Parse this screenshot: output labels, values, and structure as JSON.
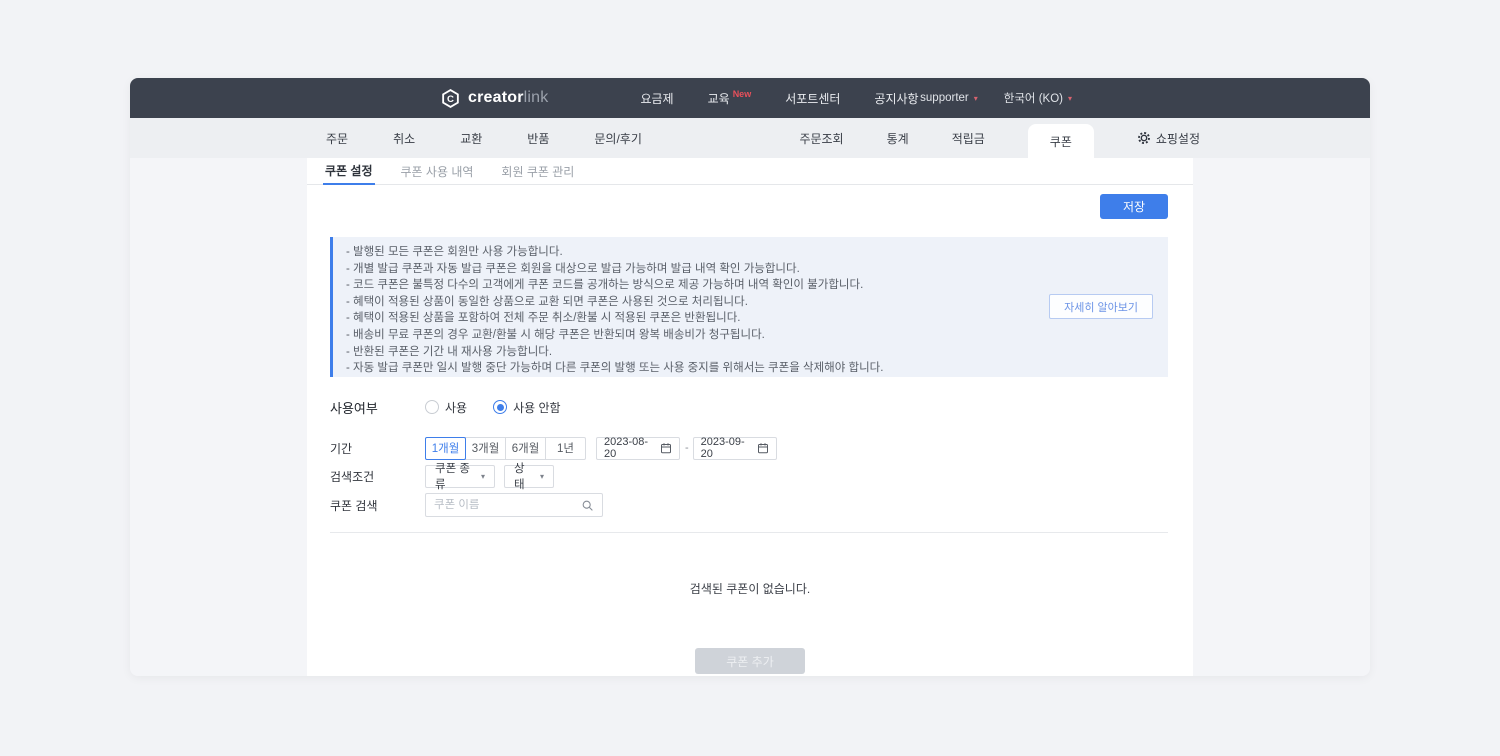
{
  "topnav": {
    "brand": {
      "bold": "creator",
      "light": "link"
    },
    "menu": [
      {
        "label": "요금제"
      },
      {
        "label": "교육",
        "badge": "New"
      },
      {
        "label": "서포트센터"
      },
      {
        "label": "공지사항"
      }
    ],
    "account": {
      "label": "supporter"
    },
    "language": {
      "label": "한국어 (KO)"
    }
  },
  "subnav": {
    "left": [
      "주문",
      "취소",
      "교환",
      "반품",
      "문의/후기"
    ],
    "right": [
      "주문조회",
      "통계",
      "적립금"
    ],
    "active_tab": "쿠폰",
    "settings_label": "쇼핑설정"
  },
  "coupon_tabs": [
    {
      "label": "쿠폰 설정",
      "active": true
    },
    {
      "label": "쿠폰 사용 내역",
      "active": false
    },
    {
      "label": "회원 쿠폰 관리",
      "active": false
    }
  ],
  "toolbar": {
    "save_label": "저장"
  },
  "notice": {
    "lines": [
      "- 발행된 모든 쿠폰은 회원만 사용 가능합니다.",
      "- 개별 발급 쿠폰과 자동 발급 쿠폰은 회원을 대상으로 발급 가능하며 발급 내역 확인 가능합니다.",
      "- 코드 쿠폰은 불특정 다수의 고객에게 쿠폰 코드를 공개하는 방식으로 제공 가능하며 내역 확인이 불가합니다.",
      "- 혜택이 적용된 상품이 동일한 상품으로 교환 되면 쿠폰은 사용된 것으로 처리됩니다.",
      "- 혜택이 적용된 상품을 포함하여 전체 주문 취소/환불 시 적용된 쿠폰은 반환됩니다.",
      "- 배송비 무료 쿠폰의 경우 교환/환불 시 해당 쿠폰은 반환되며 왕복 배송비가 청구됩니다.",
      "- 반환된 쿠폰은 기간 내 재사용 가능합니다.",
      "- 자동 발급 쿠폰만 일시 발행 중단 가능하며 다른 쿠폰의 발행 또는 사용 중지를 위해서는 쿠폰을 삭제해야 합니다."
    ],
    "learn_more_label": "자세히 알아보기"
  },
  "form": {
    "usage": {
      "label": "사용여부",
      "option_use": "사용",
      "option_disable": "사용 안함",
      "selected": "사용 안함"
    },
    "period": {
      "label": "기간",
      "presets": [
        "1개월",
        "3개월",
        "6개월",
        "1년"
      ],
      "selected_preset": "1개월",
      "start_date": "2023-08-20",
      "end_date": "2023-09-20",
      "separator": "-"
    },
    "condition": {
      "label": "검색조건",
      "type_dropdown": "쿠폰 종류",
      "status_dropdown": "상태"
    },
    "search": {
      "label": "쿠폰 검색",
      "placeholder": "쿠폰 이름"
    }
  },
  "results": {
    "empty_message": "검색된 쿠폰이 없습니다."
  },
  "footer": {
    "add_coupon_label": "쿠폰 추가",
    "enabled": false
  },
  "colors": {
    "navbar": "#3c424e",
    "accent_blue": "#3e7eea",
    "badge_red": "#e8505b",
    "notice_bg": "#eef2f9",
    "disabled_button": "#cfd3d9"
  }
}
